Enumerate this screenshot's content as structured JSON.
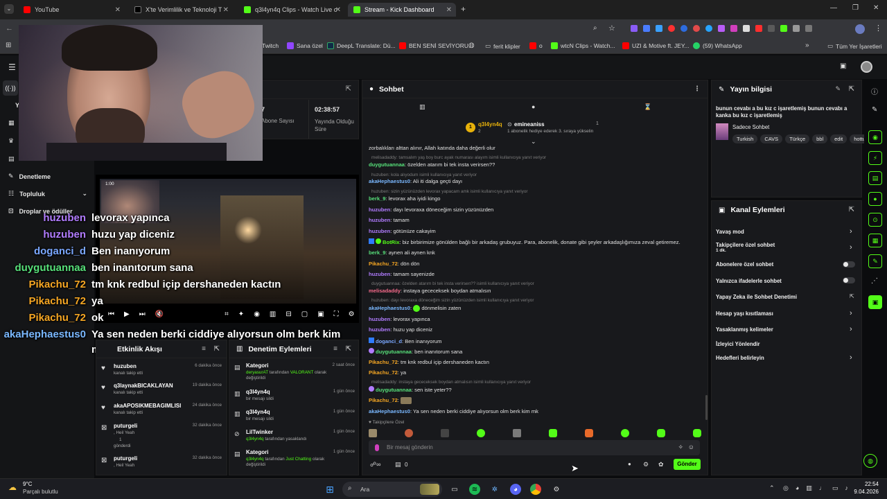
{
  "browser": {
    "tabs": [
      {
        "title": "YouTube",
        "color": "#ff0000"
      },
      {
        "title": "X'te Verimlilik ve Teknoloji Turn",
        "color": "#ffffff"
      },
      {
        "title": "q3l4yn4q Clips - Watch Live on",
        "color": "#53fc18"
      },
      {
        "title": "Stream - Kick Dashboard",
        "color": "#53fc18"
      }
    ],
    "new_tab": "+",
    "bookmarks": [
      {
        "label": "Twitch",
        "icon": "twitch-icon"
      },
      {
        "label": "Sana özel",
        "icon": "twitch-icon"
      },
      {
        "label": "DeepL Translate: Dü...",
        "icon": "deepl-icon"
      },
      {
        "label": "BEN SENİ SEVİYORU...",
        "icon": "youtube-icon"
      },
      {
        "label": "ferit klipler",
        "icon": "folder-icon"
      },
      {
        "label": "o",
        "icon": "youtube-icon"
      },
      {
        "label": "wtcN Clips - Watch...",
        "icon": "kick-icon"
      },
      {
        "label": "UZI & Motive ft. JEY...",
        "icon": "youtube-icon"
      },
      {
        "label": "(59) WhatsApp",
        "icon": "whatsapp-icon"
      },
      {
        "label": "Tüm Yer İşaretleri",
        "icon": "folder-icon"
      }
    ]
  },
  "leftnav": {
    "items": [
      {
        "label": "Denetleme"
      },
      {
        "label": "Topluluk"
      },
      {
        "label": "Droplar ve ödüller"
      }
    ]
  },
  "stats": {
    "subs_label": "Abone Sayısı",
    "subs_value": "7",
    "uptime_value": "02:38:57",
    "uptime_label": "Yayında Olduğu Süre"
  },
  "overlay_chat": [
    {
      "user": "huzuben",
      "msg": "levorax yapınca",
      "color": "#b17cff"
    },
    {
      "user": "huzuben",
      "msg": "huzu yap diceniz",
      "color": "#b17cff"
    },
    {
      "user": "doganci_d",
      "msg": "Ben inanıyorum",
      "color": "#7aa7ff"
    },
    {
      "user": "duygutuannaa",
      "msg": "ben inanıtorum sana",
      "color": "#57e07a"
    },
    {
      "user": "Pikachu_72",
      "msg": "tm knk redbul içip dershaneden kactın",
      "color": "#f5a623"
    },
    {
      "user": "Pikachu_72",
      "msg": "ya",
      "color": "#f5a623"
    },
    {
      "user": "Pikachu_72",
      "msg": "ok",
      "color": "#f5a623"
    },
    {
      "user": "akaHephaestus0",
      "msg": "Ya sen neden berki ciddiye alıyorsun olm berk kim",
      "color": "#7ab8ff"
    }
  ],
  "overlay_wrap": "mk",
  "activity": {
    "title": "Etkinlik Akışı",
    "events": [
      {
        "name": "huzuben",
        "desc": "kanalı takip etti",
        "time": "6 dakika önce",
        "icon": "heart-icon"
      },
      {
        "name": "q3laynakBICAKLAYAN",
        "desc": "kanalı takip etti",
        "time": "19 dakika önce",
        "icon": "heart-icon"
      },
      {
        "name": "akaAPOSIKMEBAGIMLISI",
        "desc": "kanalı takip etti",
        "time": "24 dakika önce",
        "icon": "heart-icon"
      },
      {
        "name": "puturgeli",
        "desc": ", Heil Yeah",
        "desc2": "1",
        "desc3": "gönderdi",
        "time": "32 dakika önce",
        "icon": "kick-icon"
      },
      {
        "name": "puturgeli",
        "desc": ", Heil Yeah",
        "time": "32 dakika önce",
        "icon": "kick-icon"
      }
    ]
  },
  "moderation": {
    "title": "Denetim Eylemleri",
    "items": [
      {
        "name": "Kategori",
        "user": "deryasurAT",
        "mid": "tarafından",
        "target": "VALORANT",
        "tail": "olarak değiştirildi",
        "time": "2 saat önce",
        "icon": "category-icon"
      },
      {
        "name": "q3l4yn4q",
        "desc": "bir mesajı sildi",
        "time": "1 gün önce",
        "icon": "trash-icon"
      },
      {
        "name": "q3l4yn4q",
        "desc": "bir mesajı sildi",
        "time": "1 gün önce",
        "icon": "trash-icon"
      },
      {
        "name": "LilTwinker",
        "user": "q3l4yn4q",
        "mid": "tarafından yasaklandı",
        "time": "1 gün önce",
        "icon": "ban-icon"
      },
      {
        "name": "Kategori",
        "user": "q3l4yn4q",
        "mid": "tarafından",
        "target": "Just Chatting",
        "tail": "olarak değiştirildi",
        "time": "1 gün önce",
        "icon": "category-icon"
      }
    ]
  },
  "chat": {
    "title": "Sohbet",
    "pinned": {
      "user": "q3l4yn4q",
      "count": "2",
      "gifter": "emineaniss",
      "gift_count": "1",
      "gift_text": "1 abonelik hediye ederek 3. sıraya yükselin"
    },
    "lines": [
      {
        "kind": "msg",
        "user": "",
        "msg": "zorbalıkları alttan alınır, Allah katında daha değerli olur",
        "color": "#e2e2e2"
      },
      {
        "kind": "reply",
        "msg": "melisadaddy: tamsalım yaş boy burc ayak numarası alayım isimli kullanıcıya yanıt veriyor"
      },
      {
        "kind": "msg",
        "user": "duygutuannaa",
        "msg": "özelden atarım bi tek insta verirsen??",
        "color": "#57e07a"
      },
      {
        "kind": "reply",
        "msg": "huzuben: kola alıyodum isimli kullanıcıya yanıt veriyor"
      },
      {
        "kind": "msg",
        "user": "akaHephaestus0",
        "msg": "Ali iti dalga geçti dayı",
        "color": "#7ab8ff"
      },
      {
        "kind": "reply",
        "msg": "huzuben: sizin yüzünüzden levorax yapacam amk isimli kullanıcıya yanıt veriyor"
      },
      {
        "kind": "msg",
        "user": "berk_9",
        "msg": "levorax aha iyidi kingo",
        "color": "#57e07a"
      },
      {
        "kind": "msg",
        "user": "huzuben",
        "msg": "dayı levoraxa döneceğim sizin yüzünüzden",
        "color": "#b17cff"
      },
      {
        "kind": "msg",
        "user": "huzuben",
        "msg": "tamam",
        "color": "#b17cff"
      },
      {
        "kind": "msg",
        "user": "huzuben",
        "msg": "götünüze cakayim",
        "color": "#b17cff"
      },
      {
        "kind": "msg",
        "user": "BotRix",
        "msg": "biz birbirimize gönülden bağlı bir arkadaş grubuyuz. Para, abonelik, donate gibi şeyler arkadaşlığımıza zeval getiremez.",
        "color": "#53fc18"
      },
      {
        "kind": "msg",
        "user": "berk_9",
        "msg": "aynen ali aynen knk",
        "color": "#57e07a"
      },
      {
        "kind": "msg",
        "user": "Pikachu_72",
        "msg": "dön dön",
        "color": "#f5a623"
      },
      {
        "kind": "msg",
        "user": "huzuben",
        "msg": "tamam sayenizde",
        "color": "#b17cff"
      },
      {
        "kind": "reply",
        "msg": "duygutuannaa: özelden atarım bi tek insta verirsen?? isimli kullanıcıya yanıt veriyor"
      },
      {
        "kind": "msg",
        "user": "melisadaddy",
        "msg": "instaya gececeksek boydan atmalısın",
        "color": "#f56a8a"
      },
      {
        "kind": "reply",
        "msg": "huzuben: dayı levoraxa döneceğim sizin yüzünüzden isimli kullanıcıya yanıt veriyor"
      },
      {
        "kind": "msg",
        "user": "akaHephaestus0",
        "msg": "dönmelisin zaten",
        "color": "#7ab8ff"
      },
      {
        "kind": "msg",
        "user": "huzuben",
        "msg": "levorax yapınca",
        "color": "#b17cff"
      },
      {
        "kind": "msg",
        "user": "huzuben",
        "msg": "huzu yap diceniz",
        "color": "#b17cff"
      },
      {
        "kind": "msg",
        "user": "doganci_d",
        "msg": "Ben inanıyorum",
        "color": "#7aa7ff"
      },
      {
        "kind": "msg",
        "user": "duygutuannaa",
        "msg": "ben inanıtorum sana",
        "color": "#57e07a"
      },
      {
        "kind": "msg",
        "user": "Pikachu_72",
        "msg": "tm knk redbul içip dershaneden kactın",
        "color": "#f5a623"
      },
      {
        "kind": "msg",
        "user": "Pikachu_72",
        "msg": "ya",
        "color": "#f5a623"
      },
      {
        "kind": "reply",
        "msg": "melisadaddy: instaya gececeksek boydan atmalısın isimli kullanıcıya yanıt veriyor"
      },
      {
        "kind": "msg",
        "user": "duygutuannaa",
        "msg": "sen iste yeter??",
        "color": "#57e07a"
      },
      {
        "kind": "msg",
        "user": "Pikachu_72",
        "msg": "",
        "color": "#f5a623"
      },
      {
        "kind": "msg",
        "user": "akaHephaestus0",
        "msg": "Ya sen neden berki ciddiye alıyorsun olm berk kim mk",
        "color": "#7ab8ff"
      }
    ],
    "followers_only": "Takipçilere Özel",
    "input_placeholder": "Bir mesaj gönderin",
    "counter": "0",
    "send": "Gönder"
  },
  "stream_info": {
    "title": "Yayın bilgisi",
    "stream_title": "bunun cevabı a bu kız c işaretlemiş bunun cevabı a kanka bu kız c işaretlemiş",
    "category": "Sadece Sohbet",
    "tags": [
      "Turkish",
      "CAVS",
      "Türkçe",
      "bbl",
      "edit",
      "hottu"
    ]
  },
  "channel_actions": {
    "title": "Kanal Eylemleri",
    "items": [
      {
        "label": "Yavaş mod",
        "ctrl": "chevron"
      },
      {
        "label": "Takipçilere özel sohbet",
        "sub": "1 dk.",
        "ctrl": "chevron"
      },
      {
        "label": "Abonelere özel sohbet",
        "ctrl": "toggle"
      },
      {
        "label": "Yalnızca ifadelerle sohbet",
        "ctrl": "toggle"
      },
      {
        "label": "Yapay Zeka ile Sohbet Denetimi",
        "ctrl": "external"
      },
      {
        "label": "Hesap yaşı kısıtlaması",
        "ctrl": "chevron"
      },
      {
        "label": "Yasaklanmış kelimeler",
        "ctrl": "chevron"
      },
      {
        "label": "İzleyici Yönlendir",
        "ctrl": "none"
      },
      {
        "label": "Hedefleri belirleyin",
        "ctrl": "chevron"
      }
    ]
  },
  "video": {
    "time": "1:00"
  },
  "taskbar": {
    "weather_temp": "9°C",
    "weather_desc": "Parçalı bulutlu",
    "search": "Ara",
    "time": "22:54",
    "date": "9.04.2026"
  },
  "colors": {
    "accent": "#53fc18",
    "panel": "#18191c",
    "bg": "#0b0c0e"
  }
}
